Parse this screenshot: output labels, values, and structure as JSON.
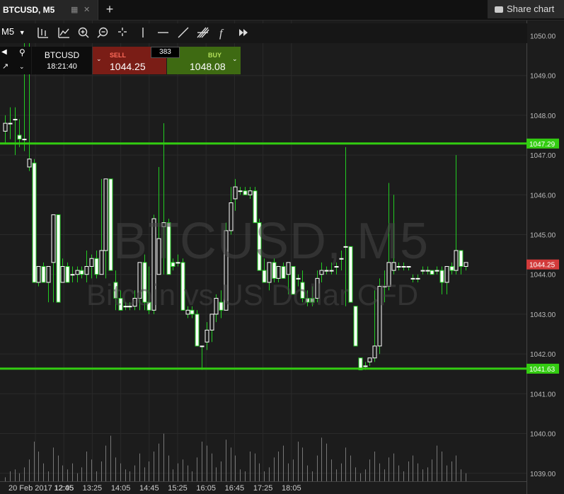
{
  "tab": {
    "title": "BTCUSD, M5"
  },
  "share_label": "Share chart",
  "toolbar": {
    "timeframe": "M5",
    "tools": [
      "bars-icon",
      "indicators-icon",
      "zoom-in-icon",
      "zoom-out-icon",
      "crosshair-icon",
      "vertical-line-icon",
      "horizontal-line-icon",
      "trend-line-icon",
      "fib-icon",
      "function-icon",
      "fast-forward-icon"
    ],
    "function_glyph": "f"
  },
  "trade": {
    "symbol": "BTCUSD",
    "time": "18:21:40",
    "sell_label": "SELL",
    "sell_price": "1044.25",
    "buy_label": "BUY",
    "buy_price": "1048.08",
    "spread": "383"
  },
  "watermark": {
    "line1": "BTCUSD, M5",
    "line2": "Bitcoin vs US Dollar CFD"
  },
  "colors": {
    "background": "#1c1c1c",
    "grid": "#2a2a2a",
    "up": "#ffffff",
    "down": "#ffffff",
    "wick": "#22cc22",
    "level": "#33cc11",
    "price_tag": "#d23a3a"
  },
  "chart_data": {
    "type": "candlestick",
    "ylim": [
      1038.8,
      1050.4
    ],
    "y_ticks": [
      "1050.00",
      "1049.00",
      "1048.00",
      "1047.00",
      "1046.00",
      "1045.00",
      "1044.00",
      "1043.00",
      "1042.00",
      "1041.00",
      "1040.00",
      "1039.00"
    ],
    "x_ticks": [
      "20 Feb 2017 12:05",
      "12:45",
      "13:25",
      "14:05",
      "14:45",
      "15:25",
      "16:05",
      "16:45",
      "17:25",
      "18:05"
    ],
    "levels": [
      {
        "value": 1047.29,
        "label": "1047.29"
      },
      {
        "value": 1041.63,
        "label": "1041.63"
      }
    ],
    "current_price": {
      "value": 1044.25,
      "label": "1044.25"
    },
    "candles": [
      {
        "o": 1047.6,
        "h": 1048.0,
        "l": 1047.3,
        "c": 1047.8
      },
      {
        "o": 1047.8,
        "h": 1048.2,
        "l": 1047.4,
        "c": 1047.8
      },
      {
        "o": 1047.9,
        "h": 1048.2,
        "l": 1047.0,
        "c": 1047.9
      },
      {
        "o": 1047.5,
        "h": 1047.9,
        "l": 1047.2,
        "c": 1047.4
      },
      {
        "o": 1047.4,
        "h": 1050.0,
        "l": 1047.1,
        "c": 1047.4
      },
      {
        "o": 1046.7,
        "h": 1050.0,
        "l": 1046.6,
        "c": 1046.9
      },
      {
        "o": 1046.8,
        "h": 1046.9,
        "l": 1043.8,
        "c": 1043.8
      },
      {
        "o": 1043.8,
        "h": 1044.2,
        "l": 1043.7,
        "c": 1044.2
      },
      {
        "o": 1044.2,
        "h": 1044.3,
        "l": 1043.8,
        "c": 1043.8
      },
      {
        "o": 1043.8,
        "h": 1044.2,
        "l": 1043.3,
        "c": 1044.2
      },
      {
        "o": 1044.3,
        "h": 1045.5,
        "l": 1043.3,
        "c": 1045.5
      },
      {
        "o": 1045.5,
        "h": 1045.5,
        "l": 1043.3,
        "c": 1043.3
      },
      {
        "o": 1043.8,
        "h": 1044.4,
        "l": 1043.8,
        "c": 1044.2
      },
      {
        "o": 1044.2,
        "h": 1044.3,
        "l": 1043.8,
        "c": 1043.8
      },
      {
        "o": 1044.0,
        "h": 1044.2,
        "l": 1043.8,
        "c": 1044.0
      },
      {
        "o": 1044.0,
        "h": 1044.2,
        "l": 1043.8,
        "c": 1044.1
      },
      {
        "o": 1044.1,
        "h": 1044.2,
        "l": 1043.9,
        "c": 1044.0
      },
      {
        "o": 1044.0,
        "h": 1044.6,
        "l": 1043.8,
        "c": 1044.2
      },
      {
        "o": 1044.2,
        "h": 1044.5,
        "l": 1043.9,
        "c": 1044.4
      },
      {
        "o": 1044.4,
        "h": 1044.6,
        "l": 1043.9,
        "c": 1044.0
      },
      {
        "o": 1044.0,
        "h": 1046.4,
        "l": 1044.0,
        "c": 1044.6
      },
      {
        "o": 1044.6,
        "h": 1046.4,
        "l": 1043.9,
        "c": 1046.4
      },
      {
        "o": 1046.4,
        "h": 1046.4,
        "l": 1044.1,
        "c": 1044.1
      },
      {
        "o": 1043.8,
        "h": 1044.1,
        "l": 1043.1,
        "c": 1043.4
      },
      {
        "o": 1043.4,
        "h": 1043.6,
        "l": 1043.1,
        "c": 1043.1
      },
      {
        "o": 1043.2,
        "h": 1043.3,
        "l": 1043.1,
        "c": 1043.2
      },
      {
        "o": 1043.2,
        "h": 1043.3,
        "l": 1043.1,
        "c": 1043.2
      },
      {
        "o": 1043.2,
        "h": 1043.6,
        "l": 1043.1,
        "c": 1043.4
      },
      {
        "o": 1043.4,
        "h": 1044.3,
        "l": 1043.1,
        "c": 1044.3
      },
      {
        "o": 1044.3,
        "h": 1044.5,
        "l": 1043.1,
        "c": 1043.3
      },
      {
        "o": 1043.3,
        "h": 1044.2,
        "l": 1043.0,
        "c": 1043.1
      },
      {
        "o": 1043.1,
        "h": 1045.5,
        "l": 1043.0,
        "c": 1045.4
      },
      {
        "o": 1044.0,
        "h": 1046.7,
        "l": 1044.0,
        "c": 1044.9
      },
      {
        "o": 1045.2,
        "h": 1047.8,
        "l": 1044.0,
        "c": 1045.3
      },
      {
        "o": 1045.3,
        "h": 1045.4,
        "l": 1044.0,
        "c": 1044.0
      },
      {
        "o": 1044.3,
        "h": 1044.4,
        "l": 1044.1,
        "c": 1044.2
      },
      {
        "o": 1044.3,
        "h": 1044.5,
        "l": 1044.2,
        "c": 1044.3
      },
      {
        "o": 1044.3,
        "h": 1044.4,
        "l": 1043.1,
        "c": 1043.1
      },
      {
        "o": 1043.0,
        "h": 1043.2,
        "l": 1042.9,
        "c": 1043.1
      },
      {
        "o": 1043.1,
        "h": 1043.2,
        "l": 1042.9,
        "c": 1043.0
      },
      {
        "o": 1043.0,
        "h": 1043.1,
        "l": 1042.2,
        "c": 1042.2
      },
      {
        "o": 1042.2,
        "h": 1042.2,
        "l": 1041.6,
        "c": 1042.2
      },
      {
        "o": 1042.3,
        "h": 1042.8,
        "l": 1042.1,
        "c": 1042.6
      },
      {
        "o": 1042.6,
        "h": 1043.0,
        "l": 1042.3,
        "c": 1043.0
      },
      {
        "o": 1043.0,
        "h": 1043.5,
        "l": 1042.8,
        "c": 1043.4
      },
      {
        "o": 1043.3,
        "h": 1043.6,
        "l": 1042.9,
        "c": 1043.1
      },
      {
        "o": 1043.1,
        "h": 1045.3,
        "l": 1043.1,
        "c": 1045.1
      },
      {
        "o": 1045.1,
        "h": 1046.2,
        "l": 1045.0,
        "c": 1045.8
      },
      {
        "o": 1045.9,
        "h": 1046.4,
        "l": 1045.6,
        "c": 1046.2
      },
      {
        "o": 1046.1,
        "h": 1046.2,
        "l": 1046.0,
        "c": 1046.1
      },
      {
        "o": 1046.1,
        "h": 1046.2,
        "l": 1046.0,
        "c": 1046.0
      },
      {
        "o": 1046.0,
        "h": 1046.2,
        "l": 1045.9,
        "c": 1046.1
      },
      {
        "o": 1046.1,
        "h": 1046.2,
        "l": 1045.3,
        "c": 1045.3
      },
      {
        "o": 1045.3,
        "h": 1045.4,
        "l": 1044.1,
        "c": 1044.1
      },
      {
        "o": 1044.1,
        "h": 1044.4,
        "l": 1043.8,
        "c": 1043.8
      },
      {
        "o": 1043.8,
        "h": 1044.3,
        "l": 1043.6,
        "c": 1044.3
      },
      {
        "o": 1044.3,
        "h": 1044.4,
        "l": 1043.8,
        "c": 1043.9
      },
      {
        "o": 1043.9,
        "h": 1044.2,
        "l": 1043.8,
        "c": 1044.2
      },
      {
        "o": 1044.2,
        "h": 1044.3,
        "l": 1043.9,
        "c": 1043.9
      },
      {
        "o": 1044.0,
        "h": 1044.3,
        "l": 1043.5,
        "c": 1044.3
      },
      {
        "o": 1044.2,
        "h": 1044.2,
        "l": 1043.5,
        "c": 1043.5
      },
      {
        "o": 1043.9,
        "h": 1044.0,
        "l": 1043.7,
        "c": 1043.9
      },
      {
        "o": 1043.8,
        "h": 1044.1,
        "l": 1043.3,
        "c": 1043.4
      },
      {
        "o": 1043.4,
        "h": 1043.6,
        "l": 1043.2,
        "c": 1043.3
      },
      {
        "o": 1043.4,
        "h": 1043.7,
        "l": 1043.2,
        "c": 1043.3
      },
      {
        "o": 1043.4,
        "h": 1044.1,
        "l": 1043.3,
        "c": 1043.9
      },
      {
        "o": 1044.0,
        "h": 1044.3,
        "l": 1043.8,
        "c": 1044.1
      },
      {
        "o": 1044.1,
        "h": 1044.2,
        "l": 1044.0,
        "c": 1044.1
      },
      {
        "o": 1044.1,
        "h": 1044.3,
        "l": 1044.0,
        "c": 1044.1
      },
      {
        "o": 1044.2,
        "h": 1044.3,
        "l": 1044.0,
        "c": 1044.2
      },
      {
        "o": 1044.4,
        "h": 1044.6,
        "l": 1044.1,
        "c": 1044.4
      },
      {
        "o": 1044.7,
        "h": 1047.2,
        "l": 1043.2,
        "c": 1044.7
      },
      {
        "o": 1044.7,
        "h": 1044.7,
        "l": 1043.3,
        "c": 1043.3
      },
      {
        "o": 1043.2,
        "h": 1043.2,
        "l": 1042.2,
        "c": 1042.2
      },
      {
        "o": 1041.9,
        "h": 1041.9,
        "l": 1041.6,
        "c": 1041.6
      },
      {
        "o": 1041.7,
        "h": 1041.8,
        "l": 1041.6,
        "c": 1041.7
      },
      {
        "o": 1041.8,
        "h": 1041.9,
        "l": 1041.7,
        "c": 1041.9
      },
      {
        "o": 1041.9,
        "h": 1043.6,
        "l": 1041.8,
        "c": 1042.2
      },
      {
        "o": 1042.2,
        "h": 1043.9,
        "l": 1042.0,
        "c": 1043.7
      },
      {
        "o": 1043.7,
        "h": 1044.1,
        "l": 1043.3,
        "c": 1043.7
      },
      {
        "o": 1043.7,
        "h": 1046.3,
        "l": 1043.6,
        "c": 1044.3
      },
      {
        "o": 1044.1,
        "h": 1046.0,
        "l": 1044.0,
        "c": 1044.3
      },
      {
        "o": 1044.2,
        "h": 1044.3,
        "l": 1044.1,
        "c": 1044.2
      },
      {
        "o": 1044.2,
        "h": 1044.3,
        "l": 1044.1,
        "c": 1044.2
      },
      {
        "o": 1044.2,
        "h": 1044.2,
        "l": 1044.1,
        "c": 1044.2
      },
      {
        "o": 1043.9,
        "h": 1044.0,
        "l": 1043.8,
        "c": 1043.9
      },
      {
        "o": 1043.9,
        "h": 1044.0,
        "l": 1043.8,
        "c": 1043.9
      },
      {
        "o": 1044.1,
        "h": 1044.2,
        "l": 1044.0,
        "c": 1044.1
      },
      {
        "o": 1044.1,
        "h": 1044.2,
        "l": 1044.0,
        "c": 1044.1
      },
      {
        "o": 1044.1,
        "h": 1044.1,
        "l": 1044.0,
        "c": 1044.0
      },
      {
        "o": 1044.1,
        "h": 1044.2,
        "l": 1044.0,
        "c": 1044.1
      },
      {
        "o": 1044.1,
        "h": 1044.2,
        "l": 1043.5,
        "c": 1043.8
      },
      {
        "o": 1043.8,
        "h": 1044.2,
        "l": 1043.5,
        "c": 1044.2
      },
      {
        "o": 1044.2,
        "h": 1044.3,
        "l": 1044.0,
        "c": 1044.1
      },
      {
        "o": 1044.1,
        "h": 1047.0,
        "l": 1044.0,
        "c": 1044.6
      },
      {
        "o": 1044.6,
        "h": 1044.6,
        "l": 1044.0,
        "c": 1044.2
      },
      {
        "o": 1044.2,
        "h": 1044.3,
        "l": 1044.1,
        "c": 1044.3
      }
    ],
    "volume": [
      4,
      10,
      12,
      8,
      14,
      22,
      40,
      30,
      18,
      10,
      34,
      26,
      16,
      12,
      18,
      8,
      14,
      30,
      22,
      10,
      20,
      36,
      46,
      24,
      18,
      12,
      10,
      16,
      28,
      14,
      20,
      30,
      38,
      48,
      26,
      12,
      18,
      22,
      16,
      10,
      24,
      40,
      36,
      28,
      14,
      20,
      42,
      34,
      26,
      12,
      10,
      30,
      28,
      18,
      10,
      14,
      24,
      30,
      36,
      18,
      22,
      40,
      34,
      16,
      10,
      26,
      44,
      38,
      22,
      12,
      18,
      34,
      26,
      14,
      8,
      12,
      22,
      30,
      18,
      12,
      24,
      28,
      16,
      10,
      20,
      26,
      18,
      12,
      14,
      22,
      36,
      30,
      16,
      20,
      26,
      12,
      8
    ]
  }
}
